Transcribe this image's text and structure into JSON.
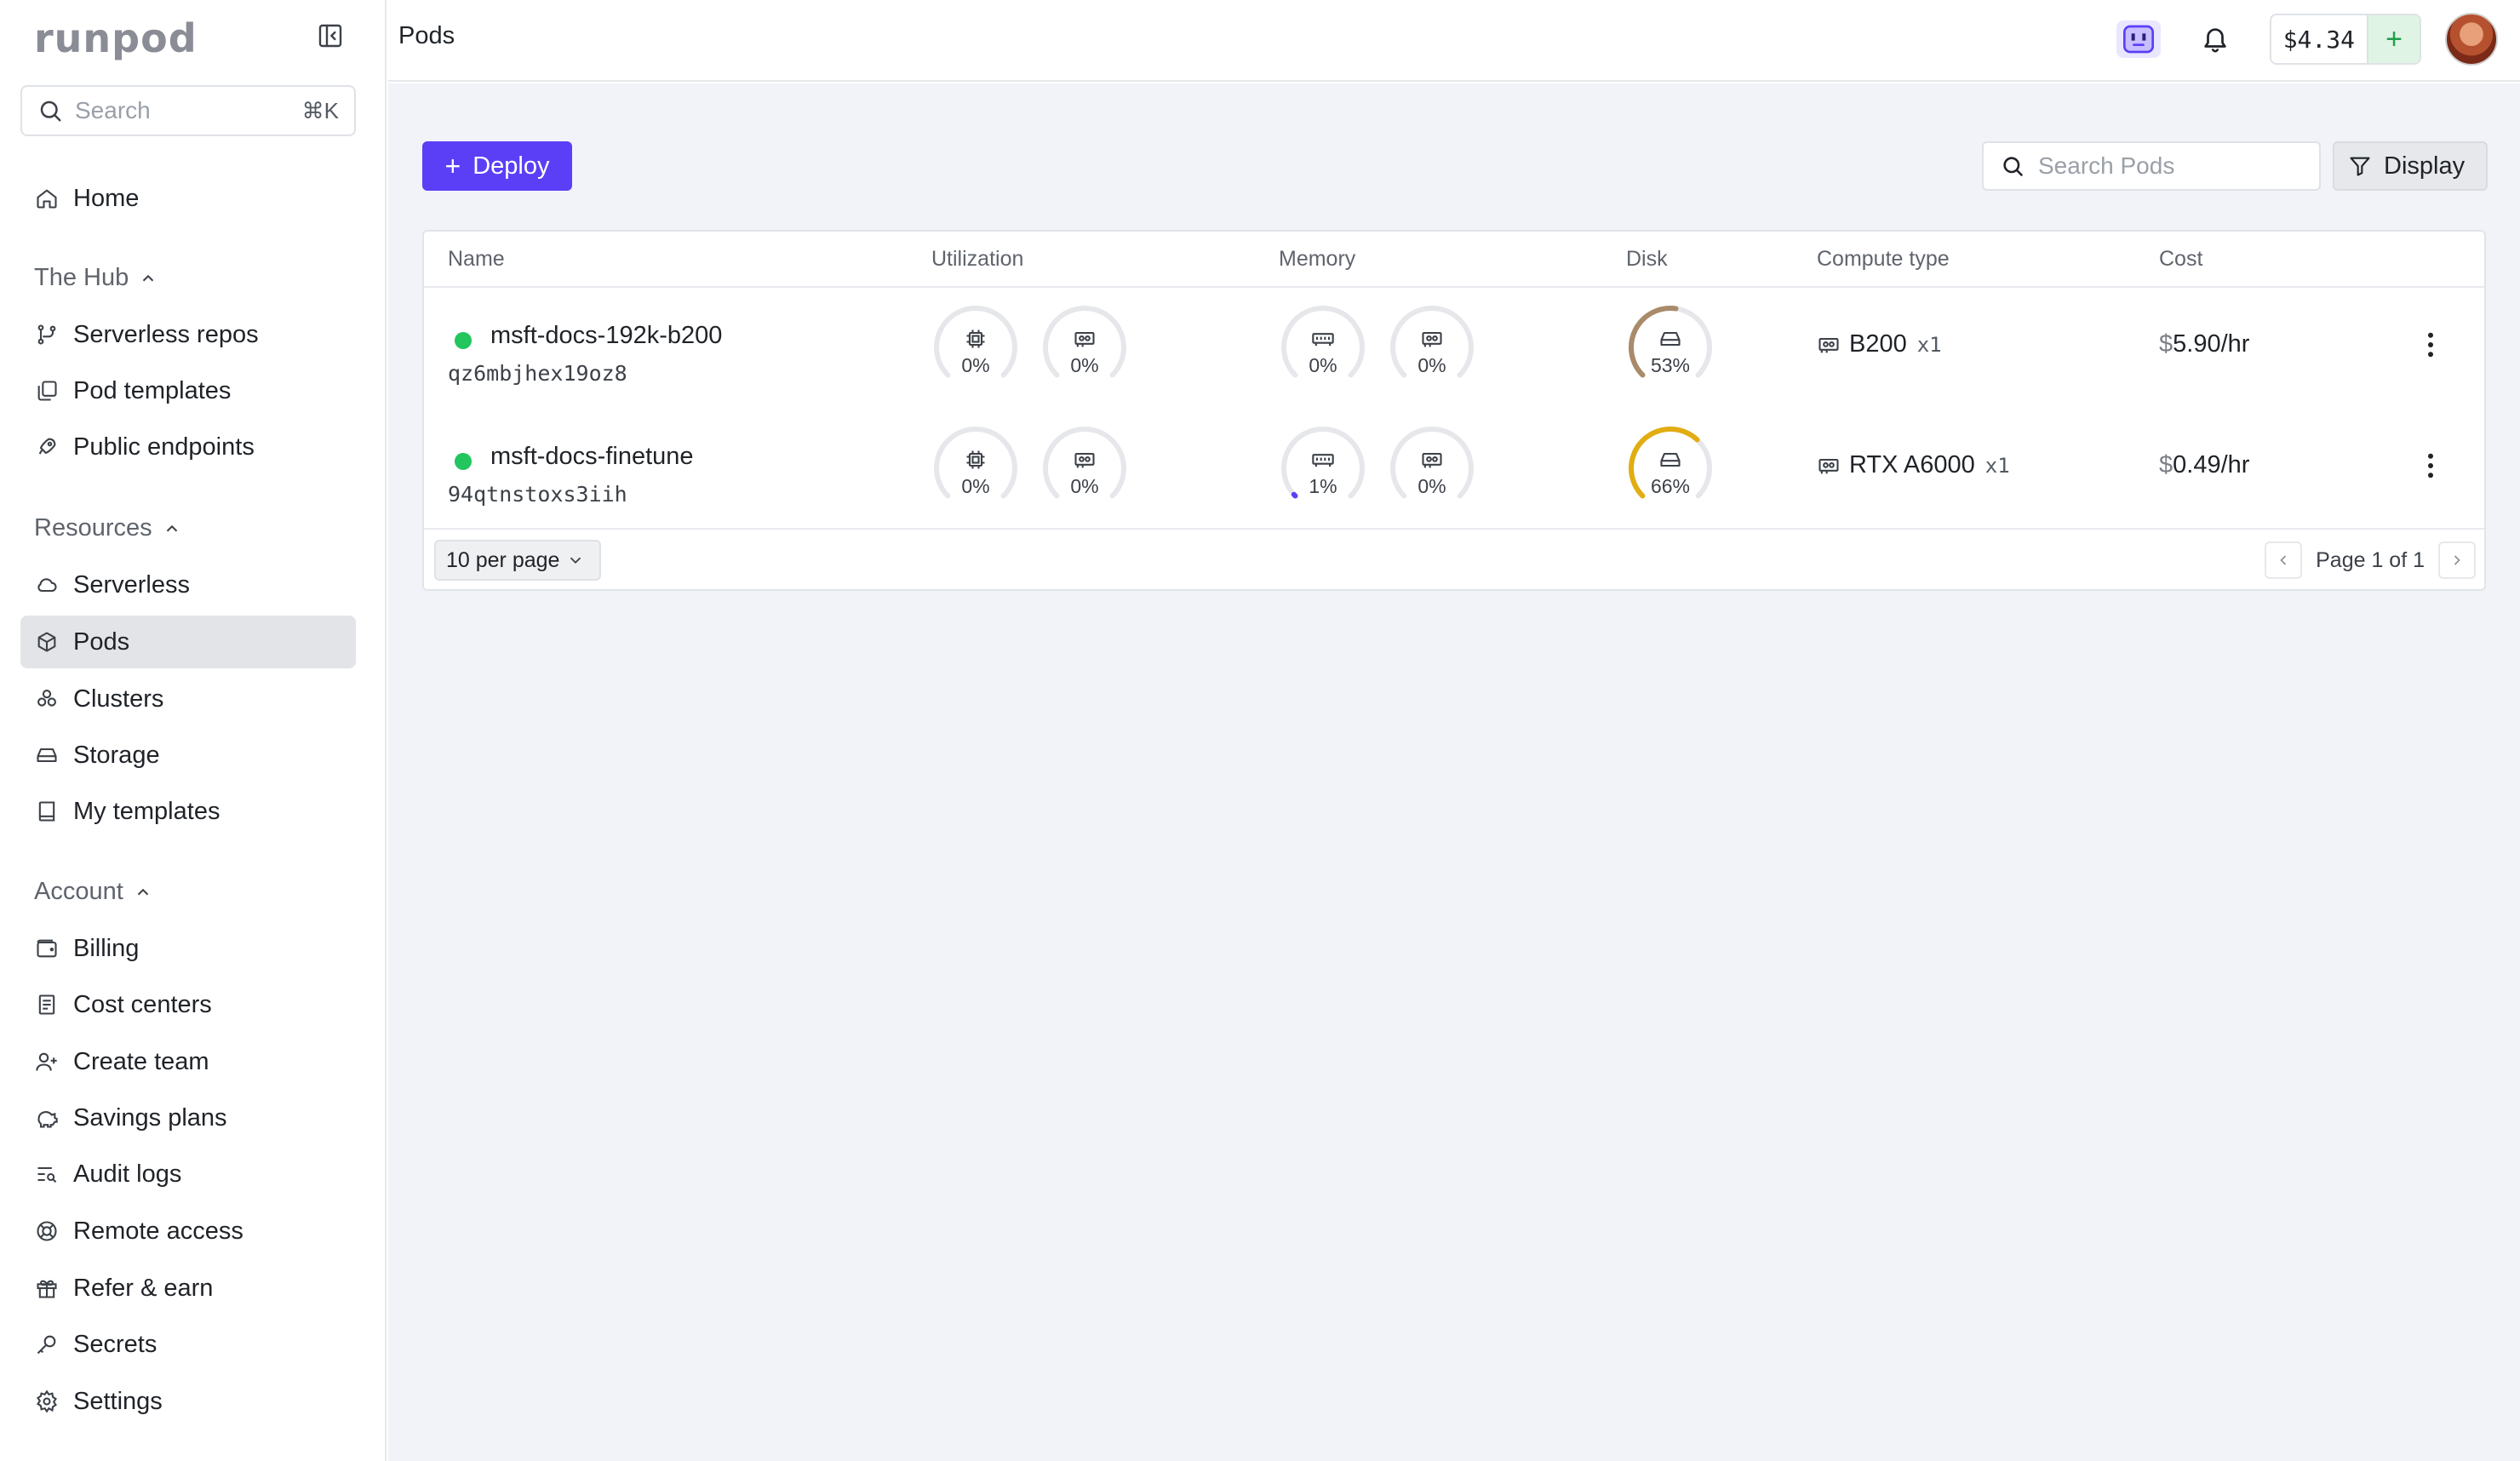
{
  "brand": {
    "logo_text": "runpod"
  },
  "sidebar": {
    "search": {
      "placeholder": "Search",
      "shortcut": "⌘K"
    },
    "home": {
      "label": "Home",
      "icon": "home-icon"
    },
    "sections": [
      {
        "title": "The Hub",
        "items": [
          {
            "label": "Serverless repos",
            "icon": "repos-icon"
          },
          {
            "label": "Pod templates",
            "icon": "templates-icon"
          },
          {
            "label": "Public endpoints",
            "icon": "rocket-icon"
          }
        ]
      },
      {
        "title": "Resources",
        "items": [
          {
            "label": "Serverless",
            "icon": "cloud-icon"
          },
          {
            "label": "Pods",
            "icon": "cube-icon",
            "active": true
          },
          {
            "label": "Clusters",
            "icon": "cluster-icon"
          },
          {
            "label": "Storage",
            "icon": "storage-icon"
          },
          {
            "label": "My templates",
            "icon": "book-icon"
          }
        ]
      },
      {
        "title": "Account",
        "items": [
          {
            "label": "Billing",
            "icon": "wallet-icon"
          },
          {
            "label": "Cost centers",
            "icon": "receipt-icon"
          },
          {
            "label": "Create team",
            "icon": "user-plus-icon"
          },
          {
            "label": "Savings plans",
            "icon": "piggy-bank-icon"
          },
          {
            "label": "Audit logs",
            "icon": "list-search-icon"
          },
          {
            "label": "Remote access",
            "icon": "lifebuoy-icon"
          },
          {
            "label": "Refer & earn",
            "icon": "gift-icon"
          },
          {
            "label": "Secrets",
            "icon": "key-icon"
          },
          {
            "label": "Settings",
            "icon": "gear-icon"
          }
        ]
      }
    ]
  },
  "topbar": {
    "page_title": "Pods",
    "balance": "$4.34",
    "add_funds": "+"
  },
  "toolbar": {
    "deploy_label": "Deploy",
    "search_placeholder": "Search Pods",
    "display_label": "Display"
  },
  "table": {
    "columns": [
      "Name",
      "Utilization",
      "Memory",
      "Disk",
      "Compute type",
      "Cost"
    ],
    "rows": [
      {
        "name": "msft-docs-192k-b200",
        "id": "qz6mbjhex19oz8",
        "status": "running",
        "cpu_util": "0%",
        "gpu_util": "0%",
        "ram": "0%",
        "vram": "0%",
        "disk": "53%",
        "compute": "B200",
        "count": "x1",
        "cost_symbol": "$",
        "cost": "5.90/hr"
      },
      {
        "name": "msft-docs-finetune",
        "id": "94qtnstoxs3iih",
        "status": "running",
        "cpu_util": "0%",
        "gpu_util": "0%",
        "ram": "1%",
        "vram": "0%",
        "disk": "66%",
        "compute": "RTX A6000",
        "count": "x1",
        "cost_symbol": "$",
        "cost": "0.49/hr"
      }
    ],
    "gauge_fractions": [
      [
        0,
        0,
        0,
        0,
        0.53
      ],
      [
        0,
        0,
        0.01,
        0,
        0.66
      ]
    ],
    "per_page": "10 per page",
    "pagination": "Page 1 of 1"
  },
  "colors": {
    "accent": "#5b3ff6",
    "status_running": "#22c55e",
    "disk_gauge_1": "#a98a6a",
    "disk_gauge_2": "#e2ad12",
    "gauge_track": "#e6e7ea"
  }
}
